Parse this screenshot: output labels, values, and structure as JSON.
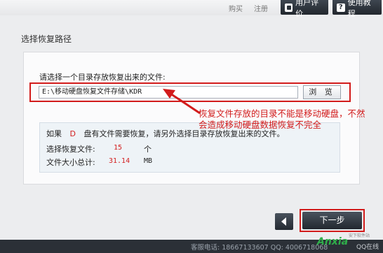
{
  "topbar": {
    "buy_label": "购买",
    "register_label": "注册",
    "review_label": "用户评价",
    "tutorial_label": "使用教程"
  },
  "section_title": "选择恢复路径",
  "prompt_label": "请选择一个目录存放恢复出来的文件:",
  "path_input": {
    "value": "E:\\移动硬盘恢复文件存储\\KDR"
  },
  "browse_label": "浏  览",
  "info": {
    "line1_pre": "如果",
    "drive": "D",
    "line1_post": "盘有文件需要恢复，请另外选择目录存放恢复出来的文件。",
    "files_label": "选择恢复文件:",
    "files_count": "15",
    "files_unit": "个",
    "size_label": "文件大小总计:",
    "size_value": "31.14",
    "size_unit": "MB"
  },
  "annotation": {
    "line1": "恢复文件存放的目录不能是移动硬盘，不然",
    "line2": "会造成移动硬盘数据恢复不完全"
  },
  "next_label": "下一步",
  "footer": {
    "text": "客服电话: 18667133607  QQ: 4006718068",
    "watermark": "Anxia",
    "watermark_sub": "安下软件站",
    "qq_online": "QQ在线"
  },
  "colors": {
    "highlight_red": "#d21b1b",
    "dark_button": "#22282f"
  }
}
